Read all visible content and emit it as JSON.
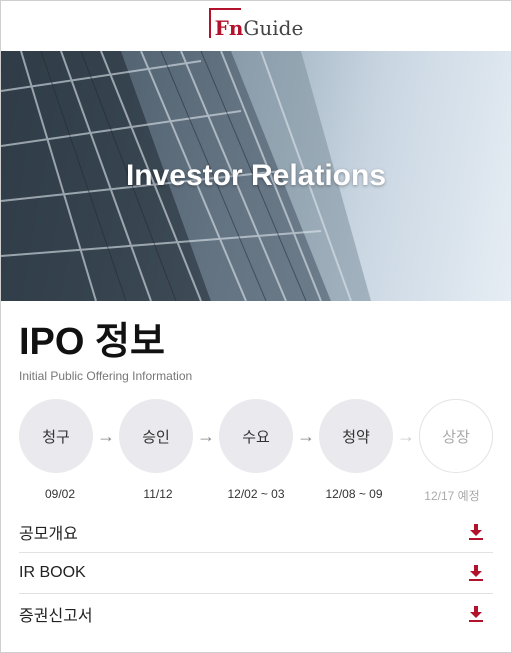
{
  "header": {
    "logo_fn": "Fn",
    "logo_guide": "Guide"
  },
  "banner": {
    "title": "Investor Relations"
  },
  "ipo": {
    "title": "IPO 정보",
    "subtitle": "Initial Public Offering Information"
  },
  "steps": [
    {
      "label": "청구",
      "date": "09/02",
      "status": "done"
    },
    {
      "label": "승인",
      "date": "11/12",
      "status": "done"
    },
    {
      "label": "수요",
      "date": "12/02 ~ 03",
      "status": "done"
    },
    {
      "label": "청약",
      "date": "12/08 ~ 09",
      "status": "done"
    },
    {
      "label": "상장",
      "date": "12/17 예정",
      "status": "pending"
    }
  ],
  "documents": [
    {
      "label": "공모개요",
      "icon": "download-icon"
    },
    {
      "label": "IR BOOK",
      "icon": "download-icon"
    },
    {
      "label": "증권신고서",
      "icon": "download-icon"
    }
  ],
  "colors": {
    "brand": "#b3122d",
    "step_bg": "#e9e9ee",
    "download": "#b3122d"
  }
}
